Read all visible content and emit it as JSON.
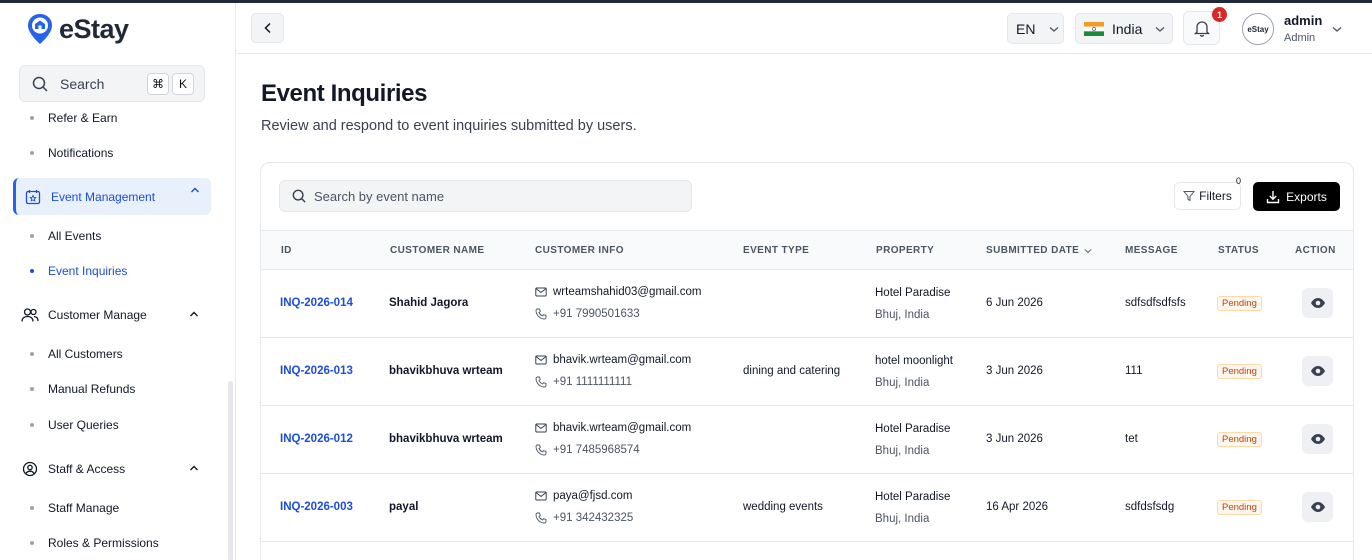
{
  "brand": {
    "name": "eStay"
  },
  "sidebar": {
    "search_label": "Search",
    "shortcut_keys": [
      "⌘",
      "K"
    ],
    "items": [
      {
        "label": "Refer & Earn",
        "kind": "sub"
      },
      {
        "label": "Notifications",
        "kind": "sub"
      },
      {
        "label": "Event Management",
        "kind": "group",
        "expanded": true,
        "active": true,
        "icon": "calendar-star-icon"
      },
      {
        "label": "All Events",
        "kind": "sub"
      },
      {
        "label": "Event Inquiries",
        "kind": "sub",
        "active": true
      },
      {
        "label": "Customer Manage",
        "kind": "group",
        "expanded": true,
        "icon": "users-icon"
      },
      {
        "label": "All Customers",
        "kind": "sub"
      },
      {
        "label": "Manual Refunds",
        "kind": "sub"
      },
      {
        "label": "User Queries",
        "kind": "sub"
      },
      {
        "label": "Staff & Access",
        "kind": "group",
        "expanded": true,
        "icon": "user-gear-icon"
      },
      {
        "label": "Staff Manage",
        "kind": "sub"
      },
      {
        "label": "Roles & Permissions",
        "kind": "sub"
      }
    ]
  },
  "topbar": {
    "language": "EN",
    "country": "India",
    "notification_count": "1",
    "avatar_text": "eStay",
    "user_name": "admin",
    "user_role": "Admin"
  },
  "page": {
    "title": "Event Inquiries",
    "subtitle": "Review and respond to event inquiries submitted by users."
  },
  "toolbar": {
    "search_placeholder": "Search by event name",
    "filters_label": "Filters",
    "filters_count": "0",
    "export_label": "Exports"
  },
  "table": {
    "columns": [
      "ID",
      "CUSTOMER NAME",
      "CUSTOMER INFO",
      "EVENT TYPE",
      "PROPERTY",
      "SUBMITTED DATE",
      "MESSAGE",
      "STATUS",
      "ACTION"
    ],
    "rows": [
      {
        "id": "INQ-2026-014",
        "name": "Shahid Jagora",
        "email": "wrteamshahid03@gmail.com",
        "phone": "+91 7990501633",
        "event_type": "",
        "property": "Hotel Paradise",
        "location": "Bhuj, India",
        "date": "6 Jun 2026",
        "message": "sdfsdfsdfsfs",
        "status": "Pending"
      },
      {
        "id": "INQ-2026-013",
        "name": "bhavikbhuva wrteam",
        "email": "bhavik.wrteam@gmail.com",
        "phone": "+91 1111111111",
        "event_type": "dining and catering",
        "property": "hotel moonlight",
        "location": "Bhuj, India",
        "date": "3 Jun 2026",
        "message": "111",
        "status": "Pending"
      },
      {
        "id": "INQ-2026-012",
        "name": "bhavikbhuva wrteam",
        "email": "bhavik.wrteam@gmail.com",
        "phone": "+91 7485968574",
        "event_type": "",
        "property": "Hotel Paradise",
        "location": "Bhuj, India",
        "date": "3 Jun 2026",
        "message": "tet",
        "status": "Pending"
      },
      {
        "id": "INQ-2026-003",
        "name": "payal",
        "email": "paya@fjsd.com",
        "phone": "+91 342432325",
        "event_type": "wedding events",
        "property": "Hotel Paradise",
        "location": "Bhuj, India",
        "date": "16 Apr 2026",
        "message": "sdfdsfsdg",
        "status": "Pending"
      }
    ]
  },
  "colors": {
    "accent": "#1d4ed8",
    "pending_text": "#c2410c",
    "pending_bg": "#fff7ed"
  }
}
